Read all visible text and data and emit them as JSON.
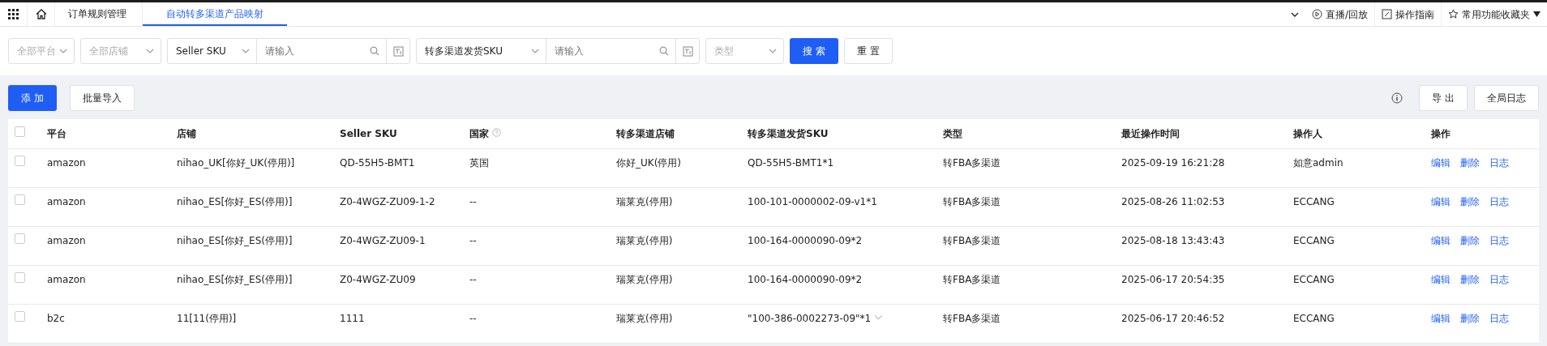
{
  "tabs": [
    {
      "label": "订单规则管理",
      "selected": false
    },
    {
      "label": "自动转多渠道产品映射",
      "selected": true
    }
  ],
  "top_links": [
    "直播/回放",
    "操作指南",
    "常用功能收藏夹"
  ],
  "filters": {
    "platform": {
      "placeholder": "全部平台"
    },
    "shop": {
      "placeholder": "全部店铺"
    },
    "sku_type": "Seller SKU",
    "sku_input": {
      "placeholder": "请输入"
    },
    "channel_sku_type": "转多渠道发货SKU",
    "channel_sku_input": {
      "placeholder": "请输入"
    },
    "type": {
      "placeholder": "类型"
    },
    "search_button": "搜 索",
    "reset_button": "重 置"
  },
  "toolbar": {
    "add_button": "添 加",
    "import_button": "批量导入",
    "export_button": "导 出",
    "log_button": "全局日志"
  },
  "table": {
    "all_checked": false,
    "columns": [
      "平台",
      "店铺",
      "Seller SKU",
      "国家",
      "转多渠道店铺",
      "转多渠道发货SKU",
      "类型",
      "最近操作时间",
      "操作人",
      "操作"
    ],
    "rows": [
      {
        "checked": false,
        "platform": "amazon",
        "shop": "nihao_UK[你好_UK(停用)]",
        "seller_sku": "QD-55H5-BMT1",
        "country": "英国",
        "channel_shop": "你好_UK(停用)",
        "channel_sku": "QD-55H5-BMT1*1",
        "expandable": false,
        "type": "转FBA多渠道",
        "time": "2025-09-19 16:21:28",
        "operator": "如意admin",
        "actions": [
          "编辑",
          "删除",
          "日志"
        ]
      },
      {
        "checked": false,
        "platform": "amazon",
        "shop": "nihao_ES[你好_ES(停用)]",
        "seller_sku": "Z0-4WGZ-ZU09-1-2",
        "country": "--",
        "channel_shop": "瑞莱克(停用)",
        "channel_sku": "100-101-0000002-09-v1*1",
        "expandable": false,
        "type": "转FBA多渠道",
        "time": "2025-08-26 11:02:53",
        "operator": "ECCANG",
        "actions": [
          "编辑",
          "删除",
          "日志"
        ]
      },
      {
        "checked": false,
        "platform": "amazon",
        "shop": "nihao_ES[你好_ES(停用)]",
        "seller_sku": "Z0-4WGZ-ZU09-1",
        "country": "--",
        "channel_shop": "瑞莱克(停用)",
        "channel_sku": "100-164-0000090-09*2",
        "expandable": false,
        "type": "转FBA多渠道",
        "time": "2025-08-18 13:43:43",
        "operator": "ECCANG",
        "actions": [
          "编辑",
          "删除",
          "日志"
        ]
      },
      {
        "checked": false,
        "platform": "amazon",
        "shop": "nihao_ES[你好_ES(停用)]",
        "seller_sku": "Z0-4WGZ-ZU09",
        "country": "--",
        "channel_shop": "瑞莱克(停用)",
        "channel_sku": "100-164-0000090-09*2",
        "expandable": false,
        "type": "转FBA多渠道",
        "time": "2025-06-17 20:54:35",
        "operator": "ECCANG",
        "actions": [
          "编辑",
          "删除",
          "日志"
        ]
      },
      {
        "checked": false,
        "platform": "b2c",
        "shop": "11[11(停用)]",
        "seller_sku": "1111",
        "country": "--",
        "channel_shop": "瑞莱克(停用)",
        "channel_sku": "\"100-386-0002273-09\"*1",
        "expandable": true,
        "type": "转FBA多渠道",
        "time": "2025-06-17 20:46:52",
        "operator": "ECCANG",
        "actions": [
          "编辑",
          "删除",
          "日志"
        ]
      }
    ]
  }
}
